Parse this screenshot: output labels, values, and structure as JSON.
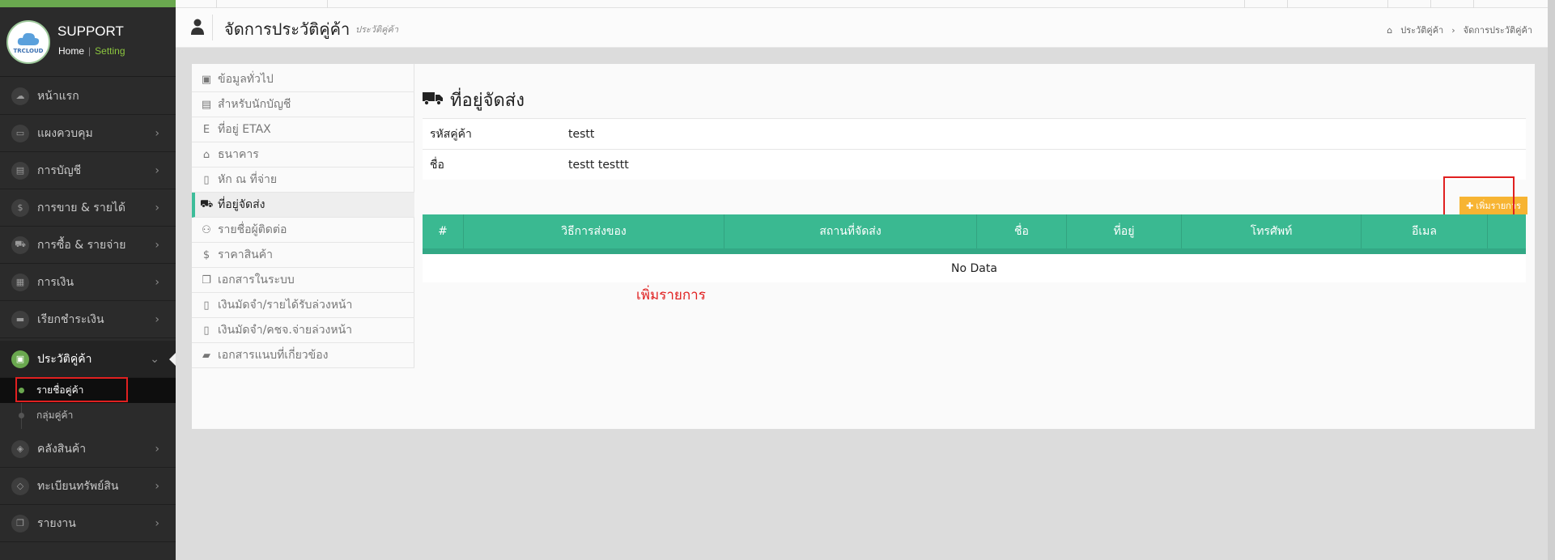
{
  "brand": {
    "company": "SUPPORT",
    "logo_text": "TRCLOUD",
    "home_link": "Home",
    "separator": "|",
    "setting_link": "Setting"
  },
  "sidebar": {
    "items": [
      {
        "label": "หน้าแรก",
        "icon": "cloud-icon",
        "glyph": "☁"
      },
      {
        "label": "แผงควบคุม",
        "icon": "monitor-icon",
        "glyph": "▭"
      },
      {
        "label": "การบัญชี",
        "icon": "book-icon",
        "glyph": "▤"
      },
      {
        "label": "การขาย & รายได้",
        "icon": "dollar-icon",
        "glyph": "$"
      },
      {
        "label": "การซื้อ & รายจ่าย",
        "icon": "cart-icon",
        "glyph": "⛟"
      },
      {
        "label": "การเงิน",
        "icon": "calendar-icon",
        "glyph": "▦"
      },
      {
        "label": "เรียกชำระเงิน",
        "icon": "card-icon",
        "glyph": "▬"
      },
      {
        "label": "ประวัติคู่ค้า",
        "icon": "contact-book-icon",
        "glyph": "▣",
        "active": true
      },
      {
        "label": "คลังสินค้า",
        "icon": "boxes-icon",
        "glyph": "◈"
      },
      {
        "label": "ทะเบียนทรัพย์สิน",
        "icon": "diamond-icon",
        "glyph": "◇"
      },
      {
        "label": "รายงาน",
        "icon": "copy-icon",
        "glyph": "❐"
      }
    ],
    "subitems": [
      {
        "label": "รายชื่อคู่ค้า",
        "active": true
      },
      {
        "label": "กลุ่มคู่ค้า"
      }
    ]
  },
  "header": {
    "title": "จัดการประวัติคู่ค้า",
    "subtitle": "ประวัติคู่ค้า",
    "breadcrumb": [
      "ประวัติคู่ค้า",
      "จัดการประวัติคู่ค้า"
    ],
    "breadcrumb_sep": "›"
  },
  "leftnav": {
    "items": [
      {
        "label": "ข้อมูลทั่วไป",
        "icon": "contact-card-icon",
        "glyph": "▣"
      },
      {
        "label": "สำหรับนักบัญชี",
        "icon": "book-icon",
        "glyph": "▤"
      },
      {
        "label": "ที่อยู่ ETAX",
        "icon": "etax-e-icon",
        "glyph": "E"
      },
      {
        "label": "ธนาคาร",
        "icon": "bank-icon",
        "glyph": "⌂"
      },
      {
        "label": "หัก ณ ที่จ่าย",
        "icon": "doc-icon",
        "glyph": "▯"
      },
      {
        "label": "ที่อยู่จัดส่ง",
        "icon": "truck-icon",
        "glyph": "⛟",
        "active": true
      },
      {
        "label": "รายชื่อผู้ติดต่อ",
        "icon": "users-icon",
        "glyph": "⚇"
      },
      {
        "label": "ราคาสินค้า",
        "icon": "dollar-icon",
        "glyph": "$"
      },
      {
        "label": "เอกสารในระบบ",
        "icon": "copy-icon",
        "glyph": "❐"
      },
      {
        "label": "เงินมัดจำ/รายได้รับล่วงหน้า",
        "icon": "file-icon",
        "glyph": "▯"
      },
      {
        "label": "เงินมัดจำ/คชจ.จ่ายล่วงหน้า",
        "icon": "file-icon",
        "glyph": "▯"
      },
      {
        "label": "เอกสารแนบที่เกี่ยวข้อง",
        "icon": "folder-icon",
        "glyph": "▰"
      }
    ]
  },
  "content": {
    "title": "ที่อยู่จัดส่ง",
    "fields": [
      {
        "label": "รหัสคู่ค้า",
        "value": "testt"
      },
      {
        "label": "ชื่อ",
        "value": "testt testtt"
      }
    ],
    "add_button": "✚ เพิ่มรายการ",
    "table": {
      "columns": [
        "#",
        "วิธีการส่งของ",
        "สถานที่จัดส่ง",
        "ชื่อ",
        "ที่อยู่",
        "โทรศัพท์",
        "อีเมล",
        ""
      ],
      "empty_text": "No Data"
    },
    "annotation": "เพิ่มรายการ"
  },
  "colors": {
    "accent": "#3ab991",
    "button": "#f7b432",
    "highlight": "#e02020",
    "sidebar_bg": "#2b2b2b",
    "brand_green": "#6aa84f"
  }
}
